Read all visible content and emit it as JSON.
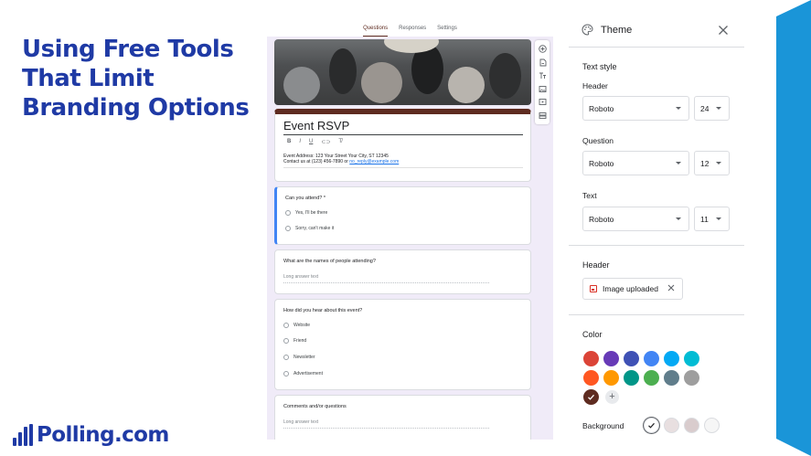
{
  "slide": {
    "title_lines": [
      "Using Free Tools",
      "That Limit",
      "Branding Options"
    ],
    "logo_text": "Polling.com",
    "accent": "#1f3aa5",
    "side_bar_color": "#1a95d8"
  },
  "forms": {
    "tabs": [
      "Questions",
      "Responses",
      "Settings"
    ],
    "active_tab": "Questions",
    "title": "Event RSVP",
    "format_buttons": [
      "B",
      "I",
      "U",
      "link",
      "clear-format"
    ],
    "description_line1": "Event Address: 123 Your Street Your City, ST 12345",
    "description_line2_prefix": "Contact us at (123) 456-7890 or ",
    "description_email": "no_reply@example.com",
    "questions": [
      {
        "title": "Can you attend? *",
        "options": [
          "Yes, I'll be there",
          "Sorry, can't make it"
        ]
      },
      {
        "title": "What are the names of people attending?",
        "answer_placeholder": "Long answer text"
      },
      {
        "title": "How did you hear about this event?",
        "options": [
          "Website",
          "Friend",
          "Newsletter",
          "Advertisement"
        ]
      },
      {
        "title": "Comments and/or questions",
        "answer_placeholder": "Long answer text"
      }
    ],
    "side_tools": [
      "add-circle-icon",
      "import-icon",
      "title-text-icon",
      "image-icon",
      "video-icon",
      "section-icon"
    ]
  },
  "theme": {
    "title": "Theme",
    "text_style_label": "Text style",
    "header_label": "Header",
    "header_font": "Roboto",
    "header_size": "24",
    "question_label": "Question",
    "question_font": "Roboto",
    "question_size": "12",
    "text_label": "Text",
    "text_font": "Roboto",
    "text_size": "11",
    "header_section_label": "Header",
    "header_image_chip": "Image uploaded",
    "color_label": "Color",
    "colors": [
      "#db4437",
      "#673ab7",
      "#3f51b5",
      "#4285f4",
      "#03a9f4",
      "#00bcd4",
      "#ff5722",
      "#ff9800",
      "#009688",
      "#4caf50",
      "#607d8b",
      "#9e9e9e"
    ],
    "selected_color": "#5e2b20",
    "background_label": "Background",
    "background_colors": [
      "#ffffff",
      "#e8dfe0",
      "#d9cccd",
      "#f6f6f6"
    ]
  }
}
